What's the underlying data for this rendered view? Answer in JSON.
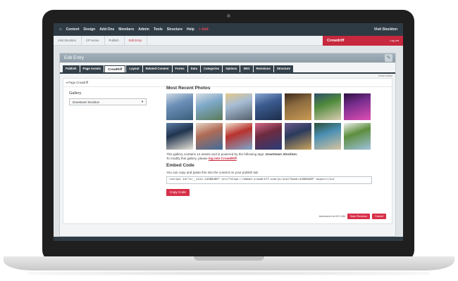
{
  "topnav": {
    "items": [
      "Content",
      "Design",
      "Add-Ons",
      "Members",
      "Admin",
      "Tools",
      "Structure",
      "Help"
    ],
    "add_label": "+ Add",
    "site_link": "Visit Stockton"
  },
  "breadcrumb": {
    "items": [
      "Visit Stockton",
      "CP Home",
      "Publish",
      "Edit Entry"
    ],
    "brand": "Crowdriff",
    "logout": "Log out"
  },
  "panel": {
    "title": "Edit Entry",
    "tabs": [
      "Publish",
      "Page Assets",
      "CrowdRiff",
      "Layout",
      "Related Content",
      "Forms",
      "Data",
      "Categories",
      "Options",
      "SEO",
      "Revisions",
      "Structure"
    ],
    "active_tab": "CrowdRiff",
    "toolbar_link": "show toolbar",
    "section_title": "▾ Page Crowdriff"
  },
  "gallery": {
    "label": "Gallery",
    "selected": "Downtown Stockton"
  },
  "recent": {
    "heading": "Most Recent Photos",
    "desc_prefix": "This gallery contains 14 assets and is powered by the following tags: ",
    "tags": "Downtown Stockton.",
    "modify_prefix": "To modify this gallery, please ",
    "modify_link": "log into CrowdRiff",
    "modify_suffix": "."
  },
  "embed": {
    "heading": "Embed Code",
    "hint": "You can copy and paste this into the content on your publish tab",
    "code": "<script id=\"cr__init-1d368d90\" src=\"https://embed.crowdriff.com/js/init?hash=1d368d90\" async></scr",
    "copy_label": "Copy Code"
  },
  "footer": {
    "autosave": "Autosaved at 8:21 AM",
    "save_revision": "Save Revision",
    "submit": "Submit"
  },
  "photos": [
    {
      "name": "photo-1",
      "colors": [
        "#6b8fb8",
        "#3a5f7a",
        "#cfd9e3"
      ]
    },
    {
      "name": "photo-2",
      "colors": [
        "#7ea9c9",
        "#5b7b5a",
        "#d7dde2"
      ]
    },
    {
      "name": "photo-3",
      "colors": [
        "#a7bdd4",
        "#55606c",
        "#e6c98b"
      ]
    },
    {
      "name": "photo-4",
      "colors": [
        "#3b5b8f",
        "#1d2d4a",
        "#89a7d1"
      ]
    },
    {
      "name": "photo-5",
      "colors": [
        "#8c6b3f",
        "#c99a55",
        "#3b2a1a"
      ]
    },
    {
      "name": "photo-6",
      "colors": [
        "#4f8a3c",
        "#d9ccb2",
        "#2d4f6b"
      ]
    },
    {
      "name": "photo-7",
      "colors": [
        "#7a2e8f",
        "#e04fb3",
        "#2a1240"
      ]
    },
    {
      "name": "photo-8",
      "colors": [
        "#20344f",
        "#e8e4d8",
        "#5c7ea6"
      ]
    },
    {
      "name": "photo-9",
      "colors": [
        "#b06b55",
        "#3f6d9c",
        "#e6d6c7"
      ]
    },
    {
      "name": "photo-10",
      "colors": [
        "#b8322d",
        "#7ba7cf",
        "#efe3d0"
      ]
    },
    {
      "name": "photo-11",
      "colors": [
        "#6d2b3f",
        "#2a3b7a",
        "#d46a8a"
      ]
    },
    {
      "name": "photo-12",
      "colors": [
        "#2b3a5c",
        "#caa45d",
        "#6c5a8c"
      ]
    },
    {
      "name": "photo-13",
      "colors": [
        "#4a8fb3",
        "#d7c4a0",
        "#2c4d36"
      ]
    },
    {
      "name": "photo-14",
      "colors": [
        "#5d8e3e",
        "#9fc2de",
        "#f0f0ee"
      ]
    }
  ],
  "colors": {
    "nav_bg": "#2f3b44",
    "brand_red": "#c7283e",
    "button_red": "#d8304a"
  }
}
